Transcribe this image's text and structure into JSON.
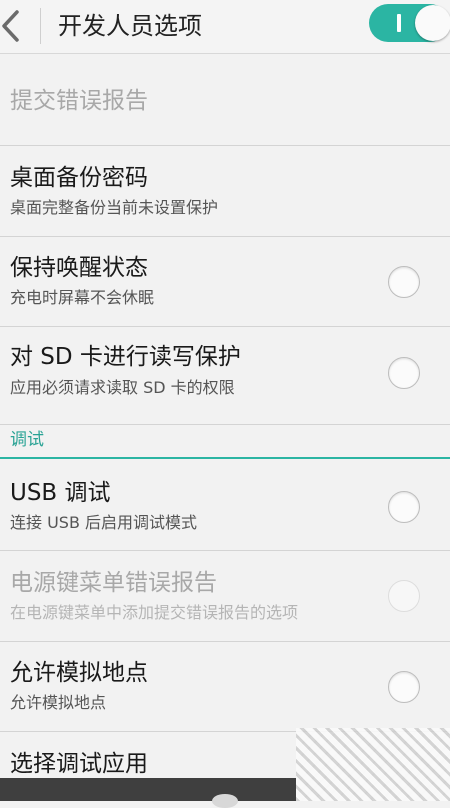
{
  "header": {
    "title": "开发人员选项",
    "master_toggle_on": true
  },
  "items": [
    {
      "title": "提交错误报告",
      "subtitle": "",
      "disabled": true,
      "has_radio": false
    },
    {
      "title": "桌面备份密码",
      "subtitle": "桌面完整备份当前未设置保护",
      "disabled": false,
      "has_radio": false
    },
    {
      "title": "保持唤醒状态",
      "subtitle": "充电时屏幕不会休眠",
      "disabled": false,
      "has_radio": true,
      "checked": false
    },
    {
      "title": "对 SD 卡进行读写保护",
      "subtitle": "应用必须请求读取 SD 卡的权限",
      "disabled": false,
      "has_radio": true,
      "checked": false
    },
    {
      "title": "USB 调试",
      "subtitle": "连接 USB 后启用调试模式",
      "disabled": false,
      "has_radio": true,
      "checked": false
    },
    {
      "title": "电源键菜单错误报告",
      "subtitle": "在电源键菜单中添加提交错误报告的选项",
      "disabled": true,
      "has_radio": true,
      "checked": false
    },
    {
      "title": "允许模拟地点",
      "subtitle": "允许模拟地点",
      "disabled": false,
      "has_radio": true,
      "checked": false
    },
    {
      "title": "选择调试应用",
      "subtitle": "",
      "disabled": false,
      "has_radio": false
    }
  ],
  "section": {
    "label": "调试"
  },
  "colors": {
    "accent": "#2bb5a3",
    "background": "#f2f2f2",
    "disabled_text": "#a8a8a8"
  }
}
